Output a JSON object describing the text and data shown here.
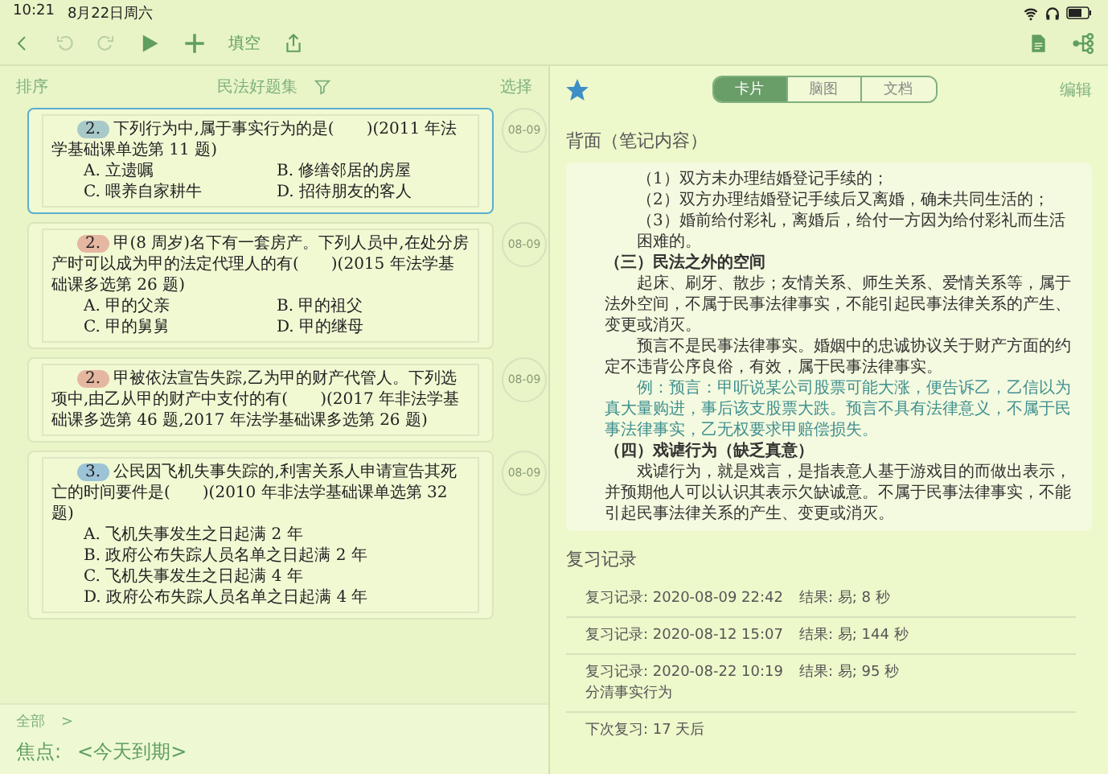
{
  "status_bar": {
    "time": "10:21",
    "date": "8月22日周六"
  },
  "toolbar": {
    "items": [
      {
        "kind": "back",
        "disabled": false
      },
      {
        "kind": "undo",
        "disabled": true
      },
      {
        "kind": "redo",
        "disabled": true
      },
      {
        "kind": "play",
        "disabled": false
      },
      {
        "kind": "add",
        "disabled": false
      },
      {
        "kind": "text",
        "label": "填空",
        "disabled": false
      },
      {
        "kind": "share",
        "disabled": false
      }
    ]
  },
  "left_header": {
    "sort": "排序",
    "title": "民法好题集",
    "select": "选择"
  },
  "cards": [
    {
      "number": "2.",
      "color": "#a9c9c9",
      "selected": true,
      "question": "下列行为中,属于事实行为的是(　　)(2011 年法学基础课单选第 11 题)",
      "kind": "grid",
      "options": [
        "A. 立遗嘱",
        "B. 修缮邻居的房屋",
        "C. 喂养自家耕牛",
        "D. 招待朋友的客人"
      ],
      "date": "08-09"
    },
    {
      "number": "2.",
      "color": "#e6b7a0",
      "selected": false,
      "question": "甲(8 周岁)名下有一套房产。下列人员中,在处分房产时可以成为甲的法定代理人的有(　　)(2015 年法学基础课多选第 26 题)",
      "kind": "grid",
      "options": [
        "A. 甲的父亲",
        "B. 甲的祖父",
        "C. 甲的舅舅",
        "D. 甲的继母"
      ],
      "date": "08-09"
    },
    {
      "number": "2.",
      "color": "#e6b7a0",
      "selected": false,
      "question": "甲被依法宣告失踪,乙为甲的财产代管人。下列选项中,由乙从甲的财产中支付的有(　　)(2017 年非法学基础课多选第 46 题,2017 年法学基础课多选第 26 题)",
      "kind": "plain",
      "date": "08-09"
    },
    {
      "number": "3.",
      "color": "#9cc3d6",
      "selected": false,
      "question": "公民因飞机失事失踪的,利害关系人申请宣告其死亡的时间要件是(　　)(2010 年非法学基础课单选第 32 题)",
      "kind": "list",
      "options": [
        "A. 飞机失事发生之日起满 2 年",
        "B. 政府公布失踪人员名单之日起满 2 年",
        "C. 飞机失事发生之日起满 4 年",
        "D. 政府公布失踪人员名单之日起满 4 年"
      ],
      "date": "08-09"
    }
  ],
  "filter_bar": {
    "scope": "全部",
    "chevron": ">",
    "focus_label": "焦点:",
    "focus_value": "<今天到期>"
  },
  "right_header": {
    "tabs": [
      {
        "label": "卡片",
        "selected": true
      },
      {
        "label": "脑图",
        "selected": false
      },
      {
        "label": "文档",
        "selected": false
      }
    ],
    "edit": "编辑",
    "starred": true
  },
  "back_title": "背面（笔记内容）",
  "note": [
    {
      "kind": "item",
      "text": "（1）双方未办理结婚登记手续的；"
    },
    {
      "kind": "item",
      "text": "（2）双方办理结婚登记手续后又离婚，确未共同生活的；"
    },
    {
      "kind": "item",
      "text": "（3）婚前给付彩礼，离婚后，给付一方因为给付彩礼而生活困难的。"
    },
    {
      "kind": "heading",
      "text": "（三）民法之外的空间"
    },
    {
      "kind": "para",
      "text": "起床、刷牙、散步；友情关系、师生关系、爱情关系等，属于法外空间，不属于民事法律事实，不能引起民事法律关系的产生、变更或消灭。"
    },
    {
      "kind": "para",
      "text": "预言不是民事法律事实。婚姻中的忠诚协议关于财产方面的约定不违背公序良俗，有效，属于民事法律事实。"
    },
    {
      "kind": "example",
      "text": "例：预言：甲听说某公司股票可能大涨，便告诉乙，乙信以为真大量购进，事后该支股票大跌。预言不具有法律意义，不属于民事法律事实，乙无权要求甲赔偿损失。"
    },
    {
      "kind": "heading",
      "text": "（四）戏谑行为（缺乏真意）"
    },
    {
      "kind": "para",
      "text": "戏谑行为，就是戏言，是指表意人基于游戏目的而做出表示，并预期他人可以认识其表示欠缺诚意。不属于民事法律事实，不能引起民事法律关系的产生、变更或消灭。"
    }
  ],
  "review": {
    "title": "复习记录",
    "records": [
      {
        "record": "复习记录: 2020-08-09 22:42",
        "result": "结果: 易; 8 秒"
      },
      {
        "record": "复习记录: 2020-08-12 15:07",
        "result": "结果: 易; 144 秒"
      },
      {
        "record": "复习记录: 2020-08-22 10:19",
        "result": "结果: 易; 95 秒",
        "note": "分清事实行为"
      }
    ],
    "next": "下次复习: 17 天后"
  }
}
